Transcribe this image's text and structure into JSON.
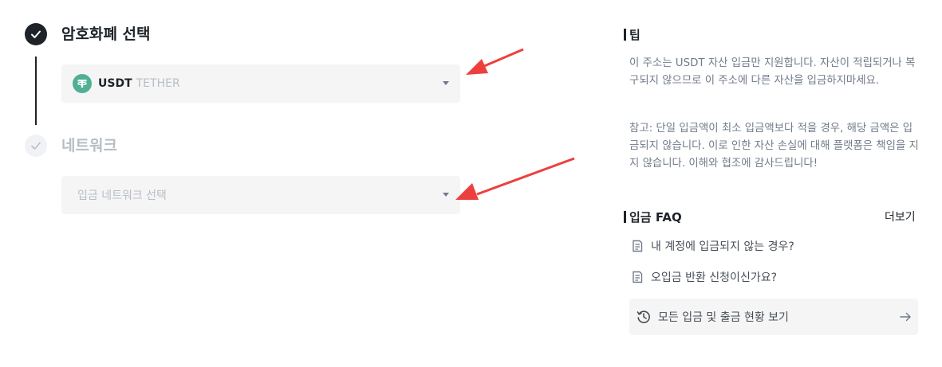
{
  "steps": [
    {
      "title": "암호화폐 선택",
      "state": "done"
    },
    {
      "title": "네트워크",
      "state": "pending"
    }
  ],
  "coin_select": {
    "symbol": "USDT",
    "name": "TETHER",
    "icon": "tether-icon",
    "icon_color": "#50af95"
  },
  "network_select": {
    "placeholder": "입금 네트워크 선택"
  },
  "tips": {
    "title": "팁",
    "paragraphs": [
      "이 주소는 USDT 자산 입금만 지원합니다. 자산이 적립되거나 복구되지 않으므로 이 주소에 다른 자산을 입금하지마세요.",
      "참고: 단일 입금액이 최소 입금액보다 적을 경우, 해당 금액은 입금되지 않습니다. 이로 인한 자산 손실에 대해 플랫폼은 책임을 지지 않습니다. 이해와 협조에 감사드립니다!"
    ]
  },
  "faq": {
    "title": "입금 FAQ",
    "more_label": "더보기",
    "items": [
      "내 계정에 입금되지 않는 경우?",
      "오입금 반환 신청이신가요?"
    ],
    "history_label": "모든 입금 및 출금 현황 보기"
  },
  "colors": {
    "annotation_arrow": "#ee3f3f",
    "text_primary": "#1e2329",
    "text_muted": "#b7bdc6"
  }
}
